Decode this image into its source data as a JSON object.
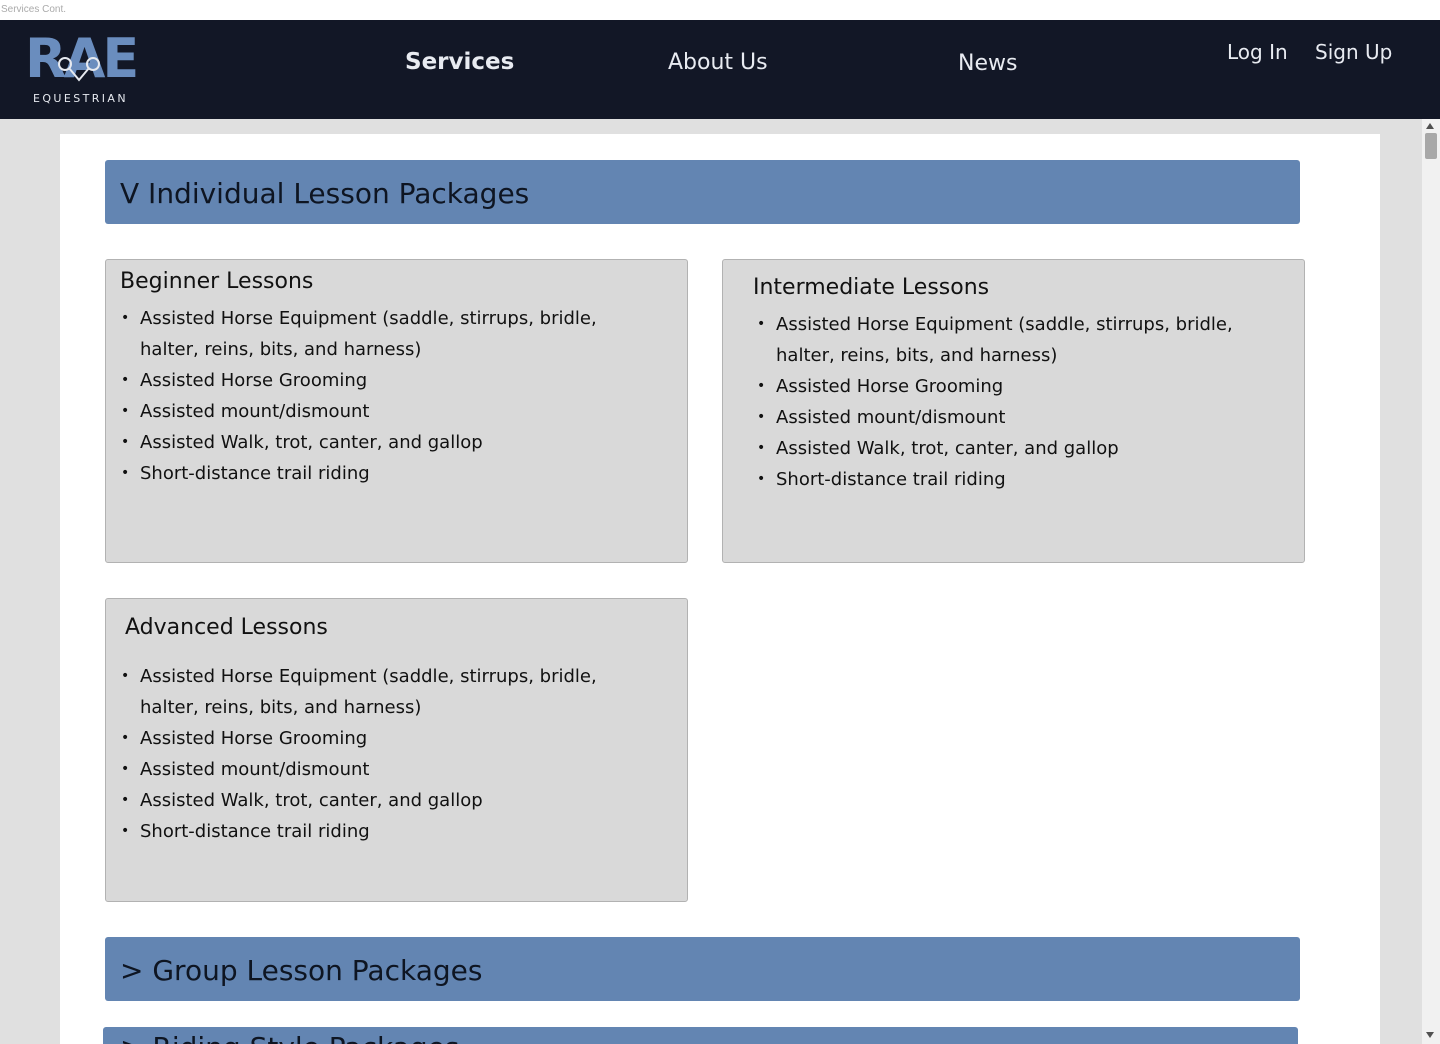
{
  "tab": {
    "title": "Services Cont."
  },
  "logo": {
    "word": "RAE",
    "sub": "EQUESTRIAN"
  },
  "nav": {
    "services": "Services",
    "about": "About Us",
    "news": "News",
    "login": "Log In",
    "signup": "Sign Up"
  },
  "sections": {
    "individual": "V Individual Lesson Packages",
    "group": "> Group Lesson Packages",
    "riding": "> Riding Style Packages"
  },
  "cards": [
    {
      "title": "Beginner Lessons",
      "items": [
        "Assisted Horse Equipment (saddle, stirrups, bridle, halter, reins, bits, and harness)",
        "Assisted Horse Grooming",
        "Assisted mount/dismount",
        "Assisted Walk, trot, canter, and gallop",
        "Short-distance trail riding"
      ]
    },
    {
      "title": "Intermediate Lessons",
      "items": [
        "Assisted Horse Equipment (saddle, stirrups, bridle, halter, reins, bits, and harness)",
        "Assisted Horse Grooming",
        "Assisted mount/dismount",
        "Assisted Walk, trot, canter, and gallop",
        "Short-distance trail riding"
      ]
    },
    {
      "title": "Advanced Lessons",
      "items": [
        "Assisted Horse Equipment (saddle, stirrups, bridle, halter, reins, bits, and harness)",
        "Assisted Horse Grooming",
        "Assisted mount/dismount",
        "Assisted Walk, trot, canter, and gallop",
        "Short-distance trail riding"
      ]
    }
  ],
  "colors": {
    "navbar": "#121726",
    "accent": "#6385b2",
    "card": "#d9d9d9"
  }
}
